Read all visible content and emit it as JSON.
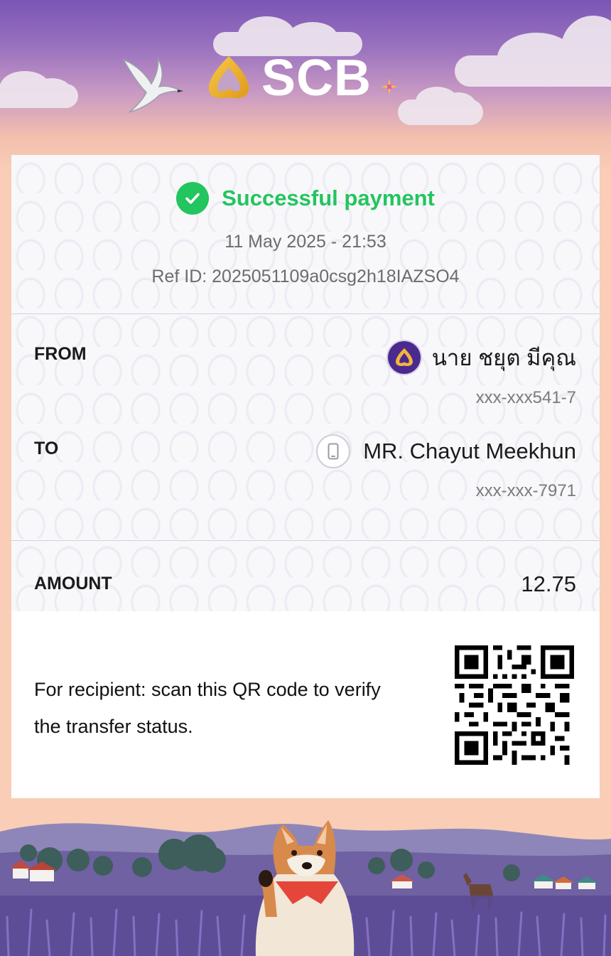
{
  "header": {
    "bank_name": "SCB",
    "brand_color": "#4a2a8f",
    "logo_icon": "scb-lotus-icon"
  },
  "receipt": {
    "status_text": "Successful payment",
    "status_color": "#22c55e",
    "status_icon": "check-circle-icon",
    "datetime": "11 May 2025 - 21:53",
    "ref_id": "Ref ID: 2025051109a0csg2h18IAZSO4"
  },
  "from": {
    "label": "FROM",
    "name": "นาย ชยุต มีคุณ",
    "account": "xxx-xxx541-7",
    "icon": "scb-bank-icon"
  },
  "to": {
    "label": "TO",
    "name": "MR. Chayut Meekhun",
    "account": "xxx-xxx-7971",
    "icon": "mobile-phone-icon"
  },
  "amount": {
    "label": "AMOUNT",
    "value": "12.75"
  },
  "qr_section": {
    "note": "For recipient: scan this QR code to verify the transfer status.",
    "icon": "qr-code-icon"
  }
}
